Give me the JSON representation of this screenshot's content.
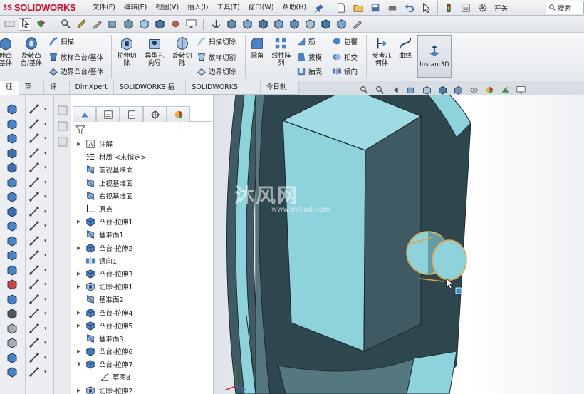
{
  "app": {
    "brand_prefix": "3S",
    "brand_name": "SOLIDWORKS"
  },
  "menus": [
    "文件(F)",
    "编辑(E)",
    "视图(V)",
    "插入(I)",
    "工具(T)",
    "窗口(W)",
    "帮助(H)"
  ],
  "topbar": {
    "start_label": "开关...",
    "search_placeholder": "搜索"
  },
  "ribbon": {
    "left_cut_1": "伸凸\n基体",
    "revolve_boss": "旋转凸\n台/基体",
    "sweep": "扫描",
    "loft_boss": "放样凸台/基体",
    "boundary_boss": "边界凸台/基体",
    "extrude_cut": "拉伸切\n除",
    "hole_wizard": "异型孔\n向导",
    "revolve_cut": "旋转切\n除",
    "sweep_cut": "扫描切除",
    "loft_cut": "放样切割",
    "boundary_cut": "边界切除",
    "fillet": "圆角",
    "linear_pattern": "线性阵\n列",
    "rib": "筋",
    "draft": "拔模",
    "shell": "抽壳",
    "wrap": "包覆",
    "intersect": "相交",
    "mirror": "镜向",
    "ref_geometry": "参考几\n何体",
    "curves": "曲线",
    "instant3d": "Instant3D"
  },
  "tabs": [
    {
      "label": "征",
      "active": true
    },
    {
      "label": "草图",
      "active": false
    },
    {
      "label": "评估",
      "active": false
    },
    {
      "label": "DimXpert",
      "active": false
    },
    {
      "label": "SOLIDWORKS 插件",
      "active": false
    },
    {
      "label": "SOLIDWORKS MBD",
      "active": false
    },
    {
      "label": "今日制造",
      "active": false
    }
  ],
  "tree": [
    {
      "label": "注解",
      "icon": "annotation-icon",
      "expand": true,
      "child": false
    },
    {
      "label": "材质 <未指定>",
      "icon": "material-icon",
      "expand": false,
      "child": false
    },
    {
      "label": "前视基准面",
      "icon": "plane-icon",
      "expand": false,
      "child": false
    },
    {
      "label": "上视基准面",
      "icon": "plane-icon",
      "expand": false,
      "child": false
    },
    {
      "label": "右视基准面",
      "icon": "plane-icon",
      "expand": false,
      "child": false
    },
    {
      "label": "原点",
      "icon": "origin-icon",
      "expand": false,
      "child": false
    },
    {
      "label": "凸台-拉伸1",
      "icon": "boss-extrude-icon",
      "expand": true,
      "child": false
    },
    {
      "label": "基准面1",
      "icon": "plane-icon",
      "expand": false,
      "child": false
    },
    {
      "label": "凸台-拉伸2",
      "icon": "boss-extrude-icon",
      "expand": true,
      "child": false
    },
    {
      "label": "镜向1",
      "icon": "mirror-icon",
      "expand": false,
      "child": false
    },
    {
      "label": "凸台-拉伸3",
      "icon": "boss-extrude-icon",
      "expand": true,
      "child": false
    },
    {
      "label": "切除-拉伸1",
      "icon": "cut-extrude-icon",
      "expand": true,
      "child": false
    },
    {
      "label": "基准面2",
      "icon": "plane-icon",
      "expand": false,
      "child": false
    },
    {
      "label": "凸台-拉伸4",
      "icon": "boss-extrude-icon",
      "expand": true,
      "child": false
    },
    {
      "label": "凸台-拉伸5",
      "icon": "boss-extrude-icon",
      "expand": true,
      "child": false
    },
    {
      "label": "基准面3",
      "icon": "plane-icon",
      "expand": false,
      "child": false
    },
    {
      "label": "凸台-拉伸6",
      "icon": "boss-extrude-icon",
      "expand": true,
      "child": false
    },
    {
      "label": "凸台-拉伸7",
      "icon": "boss-extrude-icon",
      "expand": true,
      "expanded": true,
      "child": false
    },
    {
      "label": "草图8",
      "icon": "sketch-icon",
      "expand": false,
      "child": true
    },
    {
      "label": "切除-拉伸2",
      "icon": "cut-extrude-icon",
      "expand": true,
      "child": false
    }
  ],
  "watermark": {
    "text": "沐风网",
    "url": "www.mfcad.com"
  },
  "colors": {
    "model_face_light": "#8ed3dc",
    "model_face_dark": "#3f5a62",
    "selection": "#e8a23a",
    "brand_red": "#c8102e"
  }
}
